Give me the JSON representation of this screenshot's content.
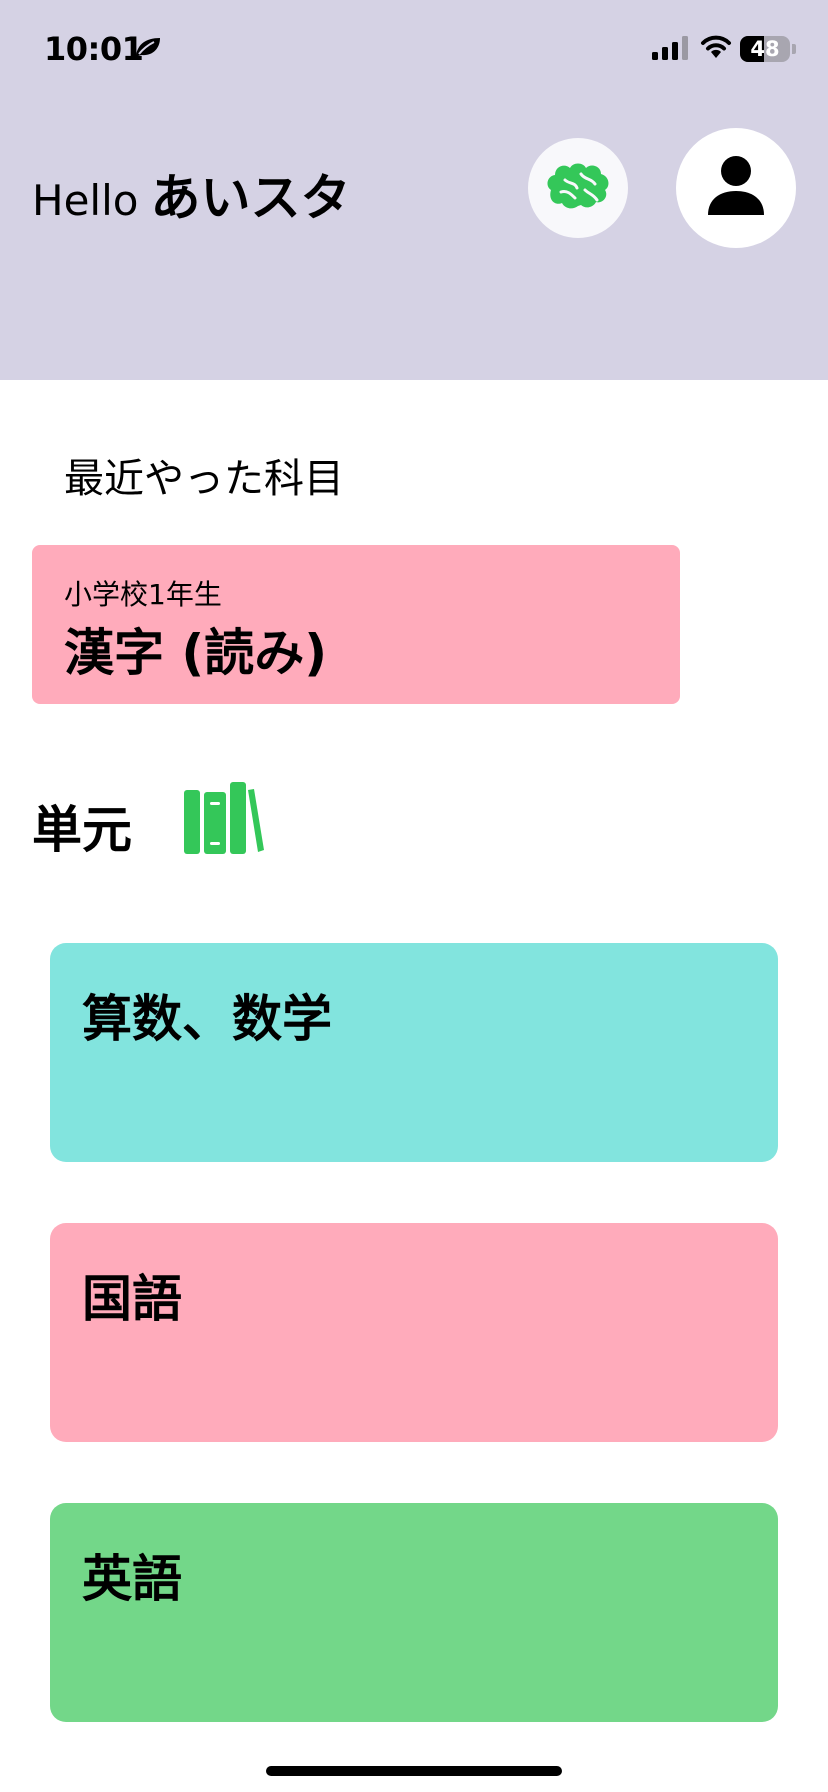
{
  "status_bar": {
    "time": "10:01",
    "battery": "48",
    "battery_level": 0.48,
    "icons": [
      "leaf-icon",
      "cellular-signal-icon",
      "wifi-icon",
      "battery-icon"
    ]
  },
  "header": {
    "greeting": "Hello",
    "username": "あいスタ",
    "brain_icon": "brain-icon",
    "profile_icon": "person-icon"
  },
  "recent": {
    "title": "最近やった科目",
    "card": {
      "grade": "小学校1年生",
      "subject": "漢字 (読み)"
    }
  },
  "units": {
    "title": "単元",
    "icon": "books-icon",
    "subjects": [
      {
        "label": "算数、数学",
        "color": "#82e4de"
      },
      {
        "label": "国語",
        "color": "#ffabbb"
      },
      {
        "label": "英語",
        "color": "#73d789"
      }
    ]
  },
  "colors": {
    "header_bg": "#d5d2e4",
    "accent_green": "#34c759",
    "recent_card": "#ffabbb"
  }
}
